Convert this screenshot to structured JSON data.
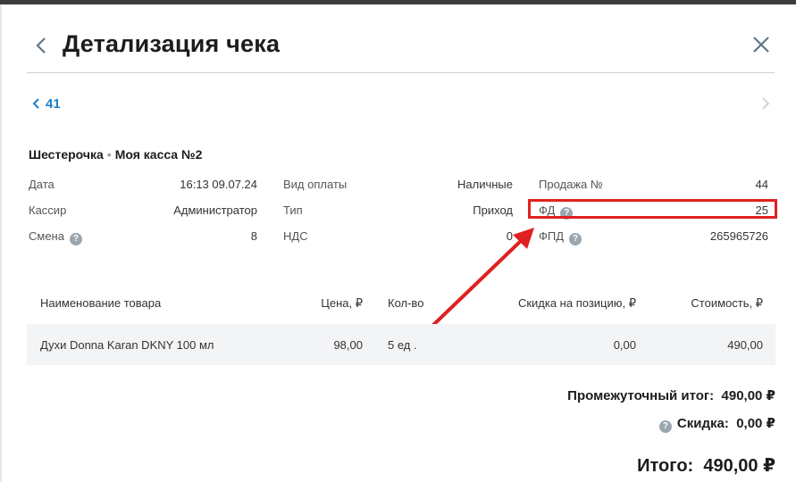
{
  "header": {
    "title": "Детализация чека"
  },
  "nav": {
    "prev_receipt_label": "41"
  },
  "store": {
    "name": "Шестерочка",
    "separator": "•",
    "register": "Моя касса №2"
  },
  "info": {
    "date_label": "Дата",
    "date_value": "16:13 09.07.24",
    "cashier_label": "Кассир",
    "cashier_value": "Администратор",
    "shift_label": "Смена",
    "shift_value": "8",
    "payment_label": "Вид оплаты",
    "payment_value": "Наличные",
    "type_label": "Тип",
    "type_value": "Приход",
    "vat_label": "НДС",
    "vat_value": "0",
    "sale_label": "Продажа №",
    "sale_value": "44",
    "fd_label": "ФД",
    "fd_value": "25",
    "fpd_label": "ФПД",
    "fpd_value": "265965726"
  },
  "table": {
    "headers": {
      "name": "Наименование товара",
      "price": "Цена, ₽",
      "qty": "Кол-во",
      "discount": "Скидка на позицию, ₽",
      "cost": "Стоимость, ₽"
    },
    "rows": [
      {
        "name": "Духи Donna Karan DKNY 100 мл",
        "price": "98,00",
        "qty": "5 ед .",
        "discount": "0,00",
        "cost": "490,00"
      }
    ]
  },
  "totals": {
    "subtotal_label": "Промежуточный итог:",
    "subtotal_value": "490,00 ₽",
    "discount_label": "Скидка:",
    "discount_value": "0,00 ₽",
    "total_label": "Итого:",
    "total_value": "490,00 ₽"
  },
  "help_glyph": "?",
  "colors": {
    "accent": "#1c7fc9",
    "annotation": "#e02020",
    "icon_grey": "#9aa6ad"
  }
}
